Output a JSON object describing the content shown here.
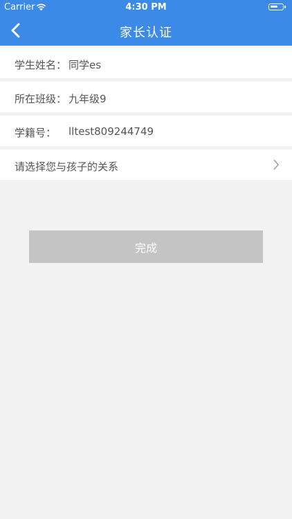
{
  "status_bar": {
    "carrier": "Carrier",
    "time": "4:30 PM"
  },
  "nav": {
    "title": "家长认证",
    "back_icon": "chevron-left-icon"
  },
  "form": {
    "rows": [
      {
        "label": "学生姓名：",
        "value": "同学es"
      },
      {
        "label": "所在班级：",
        "value": "九年级9"
      },
      {
        "label": "学籍号：",
        "value": "lltest809244749"
      }
    ],
    "relation": {
      "label": "请选择您与孩子的关系",
      "icon": "chevron-right-icon"
    }
  },
  "submit_button": {
    "label": "完成",
    "color": "#c4c4c4"
  },
  "colors": {
    "header": "#3b8ae8",
    "background": "#f2f2f2"
  }
}
